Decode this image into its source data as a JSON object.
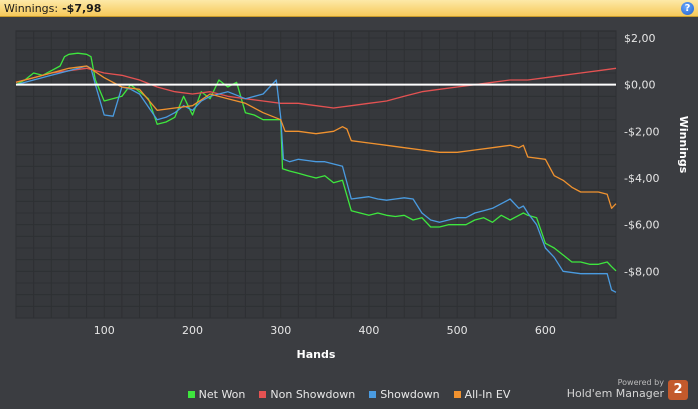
{
  "header": {
    "label": "Winnings:",
    "value": "-$7,98"
  },
  "help_icon": "help-icon",
  "brand": {
    "powered_by": "Powered by",
    "name": "Hold'em Manager",
    "logo_text": "2"
  },
  "chart_data": {
    "type": "line",
    "xlabel": "Hands",
    "ylabel": "Winnings",
    "xlim": [
      0,
      680
    ],
    "ylim": [
      -10,
      2.3
    ],
    "xticks": [
      {
        "v": 100,
        "l": "100"
      },
      {
        "v": 200,
        "l": "200"
      },
      {
        "v": 300,
        "l": "300"
      },
      {
        "v": 400,
        "l": "400"
      },
      {
        "v": 500,
        "l": "500"
      },
      {
        "v": 600,
        "l": "600"
      }
    ],
    "yticks": [
      {
        "v": 2,
        "l": "$2,00"
      },
      {
        "v": 0,
        "l": "$0,00"
      },
      {
        "v": -2,
        "l": "-$2,00"
      },
      {
        "v": -4,
        "l": "-$4,00"
      },
      {
        "v": -6,
        "l": "-$6,00"
      },
      {
        "v": -8,
        "l": "-$8,00"
      }
    ],
    "grid": true,
    "zero_line": true,
    "series": [
      {
        "name": "Net Won",
        "color": "#3ee63e",
        "x": [
          0,
          10,
          20,
          30,
          40,
          50,
          55,
          60,
          70,
          80,
          85,
          90,
          100,
          120,
          130,
          140,
          150,
          160,
          170,
          180,
          190,
          200,
          210,
          220,
          230,
          240,
          250,
          260,
          270,
          280,
          290,
          300,
          302,
          310,
          320,
          330,
          340,
          350,
          360,
          370,
          380,
          390,
          400,
          410,
          420,
          430,
          440,
          450,
          460,
          470,
          480,
          490,
          500,
          510,
          520,
          530,
          540,
          550,
          560,
          570,
          575,
          580,
          590,
          600,
          610,
          620,
          630,
          640,
          650,
          660,
          670,
          675,
          680
        ],
        "y": [
          0,
          0.2,
          0.5,
          0.4,
          0.6,
          0.8,
          1.2,
          1.3,
          1.35,
          1.3,
          1.2,
          0.2,
          -0.7,
          -0.5,
          0,
          -0.3,
          -0.6,
          -1.7,
          -1.6,
          -1.4,
          -0.5,
          -1.3,
          -0.3,
          -0.6,
          0.2,
          -0.1,
          0.1,
          -1.2,
          -1.3,
          -1.5,
          -1.5,
          -1.5,
          -3.6,
          -3.7,
          -3.8,
          -3.9,
          -4,
          -3.9,
          -4.2,
          -4.1,
          -5.4,
          -5.5,
          -5.6,
          -5.5,
          -5.6,
          -5.65,
          -5.6,
          -5.8,
          -5.7,
          -6.1,
          -6.1,
          -6,
          -6,
          -6,
          -5.8,
          -5.7,
          -5.9,
          -5.6,
          -5.8,
          -5.6,
          -5.5,
          -5.6,
          -5.7,
          -6.8,
          -7,
          -7.3,
          -7.6,
          -7.6,
          -7.7,
          -7.7,
          -7.6,
          -7.8,
          -7.98
        ]
      },
      {
        "name": "Non Showdown",
        "color": "#e45252",
        "x": [
          0,
          20,
          40,
          60,
          80,
          100,
          120,
          140,
          160,
          180,
          200,
          220,
          240,
          260,
          280,
          300,
          320,
          340,
          360,
          380,
          400,
          420,
          440,
          460,
          480,
          500,
          520,
          540,
          560,
          580,
          600,
          620,
          640,
          660,
          680
        ],
        "y": [
          0.1,
          0.3,
          0.5,
          0.6,
          0.7,
          0.5,
          0.4,
          0.2,
          -0.1,
          -0.3,
          -0.4,
          -0.3,
          -0.5,
          -0.6,
          -0.7,
          -0.8,
          -0.8,
          -0.9,
          -1,
          -0.9,
          -0.8,
          -0.7,
          -0.5,
          -0.3,
          -0.2,
          -0.1,
          0,
          0.1,
          0.2,
          0.2,
          0.3,
          0.4,
          0.5,
          0.6,
          0.7
        ]
      },
      {
        "name": "Showdown",
        "color": "#4a9be0",
        "x": [
          0,
          20,
          40,
          60,
          80,
          85,
          90,
          100,
          110,
          120,
          130,
          140,
          160,
          170,
          180,
          190,
          200,
          210,
          220,
          240,
          260,
          280,
          295,
          300,
          303,
          310,
          320,
          330,
          340,
          350,
          360,
          370,
          380,
          390,
          400,
          410,
          420,
          430,
          440,
          450,
          460,
          470,
          480,
          490,
          500,
          510,
          520,
          530,
          540,
          560,
          570,
          575,
          580,
          590,
          600,
          610,
          620,
          640,
          660,
          670,
          675,
          680
        ],
        "y": [
          0,
          0.2,
          0.4,
          0.6,
          0.8,
          0.7,
          0,
          -1.3,
          -1.35,
          -0.1,
          -0.2,
          -0.4,
          -1.5,
          -1.4,
          -1.2,
          -0.9,
          -1.1,
          -0.7,
          -0.5,
          -0.3,
          -0.6,
          -0.4,
          0.2,
          -1.4,
          -3.2,
          -3.3,
          -3.2,
          -3.25,
          -3.3,
          -3.3,
          -3.4,
          -3.5,
          -4.9,
          -4.85,
          -4.8,
          -4.9,
          -4.95,
          -4.9,
          -4.85,
          -4.9,
          -5.5,
          -5.8,
          -5.9,
          -5.8,
          -5.7,
          -5.7,
          -5.5,
          -5.4,
          -5.3,
          -4.9,
          -5.3,
          -5.2,
          -5.5,
          -6,
          -7,
          -7.4,
          -8,
          -8.1,
          -8.1,
          -8.1,
          -8.8,
          -8.9
        ]
      },
      {
        "name": "All-In EV",
        "color": "#f0922f",
        "x": [
          0,
          20,
          40,
          60,
          80,
          100,
          120,
          140,
          160,
          180,
          200,
          220,
          240,
          260,
          280,
          300,
          305,
          320,
          340,
          360,
          370,
          375,
          380,
          400,
          420,
          440,
          460,
          480,
          500,
          520,
          540,
          560,
          570,
          575,
          580,
          600,
          610,
          620,
          630,
          640,
          650,
          660,
          670,
          675,
          680
        ],
        "y": [
          0.1,
          0.3,
          0.5,
          0.7,
          0.8,
          0.3,
          -0.1,
          -0.2,
          -1.1,
          -1,
          -0.9,
          -0.4,
          -0.6,
          -0.8,
          -1.2,
          -1.5,
          -2,
          -2,
          -2.1,
          -2,
          -1.8,
          -1.9,
          -2.4,
          -2.5,
          -2.6,
          -2.7,
          -2.8,
          -2.9,
          -2.9,
          -2.8,
          -2.7,
          -2.6,
          -2.7,
          -2.6,
          -3.1,
          -3.2,
          -3.9,
          -4.1,
          -4.4,
          -4.6,
          -4.6,
          -4.6,
          -4.7,
          -5.3,
          -5.1
        ]
      }
    ]
  }
}
